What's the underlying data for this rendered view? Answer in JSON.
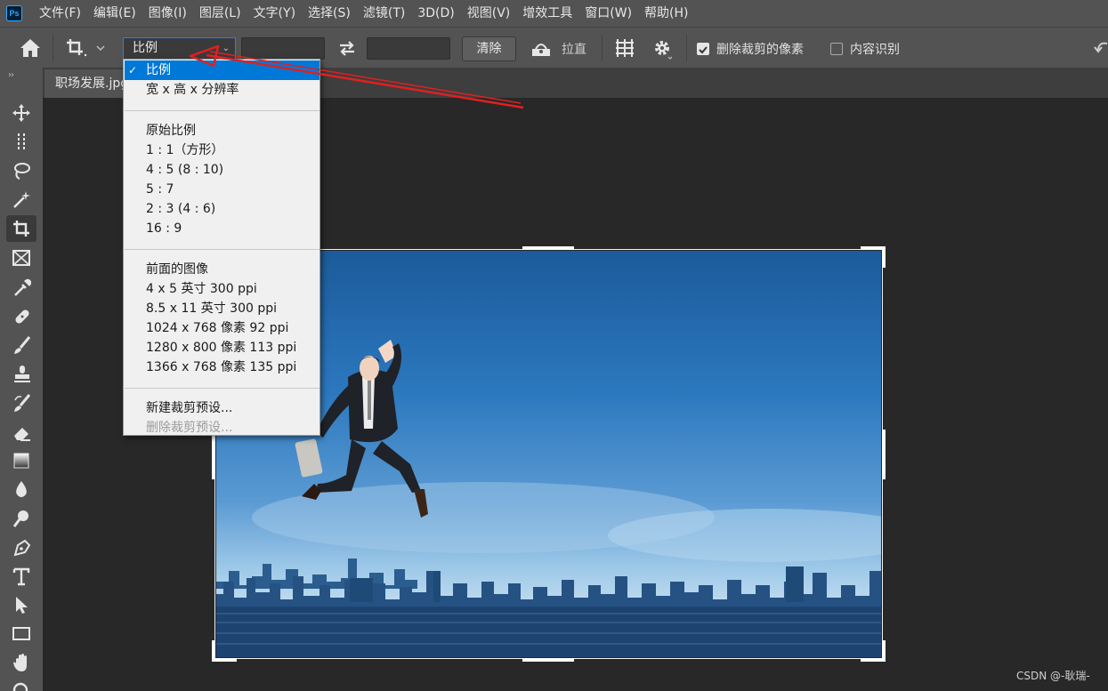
{
  "app": {
    "logo_text": "Ps"
  },
  "menu": [
    "文件(F)",
    "编辑(E)",
    "图像(I)",
    "图层(L)",
    "文字(Y)",
    "选择(S)",
    "滤镜(T)",
    "3D(D)",
    "视图(V)",
    "增效工具",
    "窗口(W)",
    "帮助(H)"
  ],
  "options": {
    "ratio_value": "比例",
    "width_value": "",
    "height_value": "",
    "clear_label": "清除",
    "straighten_label": "拉直",
    "delete_cropped_label": "删除裁剪的像素",
    "delete_cropped_checked": true,
    "content_aware_label": "内容识别",
    "content_aware_checked": false
  },
  "document": {
    "tab_title": "职场发展.jpg"
  },
  "dropdown": {
    "groups": [
      [
        {
          "label": "比例",
          "selected": true
        },
        {
          "label": "宽 x 高 x 分辨率"
        }
      ],
      [
        {
          "label": "原始比例"
        },
        {
          "label": "1 : 1（方形）"
        },
        {
          "label": "4 : 5 (8 : 10)"
        },
        {
          "label": "5 : 7"
        },
        {
          "label": "2 : 3 (4 : 6)"
        },
        {
          "label": "16 : 9"
        }
      ],
      [
        {
          "label": "前面的图像"
        },
        {
          "label": "4 x 5 英寸 300 ppi"
        },
        {
          "label": "8.5 x 11 英寸 300 ppi"
        },
        {
          "label": "1024 x 768 像素 92 ppi"
        },
        {
          "label": "1280 x 800 像素 113 ppi"
        },
        {
          "label": "1366 x 768 像素 135 ppi"
        }
      ],
      [
        {
          "label": "新建裁剪预设..."
        },
        {
          "label": "删除裁剪预设...",
          "disabled": true
        }
      ]
    ]
  },
  "tools": [
    "move-tool-icon",
    "marquee-tool-icon",
    "lasso-tool-icon",
    "magic-wand-tool-icon",
    "crop-tool-icon",
    "frame-tool-icon",
    "eyedropper-tool-icon",
    "healing-brush-tool-icon",
    "brush-tool-icon",
    "stamp-tool-icon",
    "history-brush-tool-icon",
    "eraser-tool-icon",
    "gradient-tool-icon",
    "blur-tool-icon",
    "dodge-tool-icon",
    "pen-tool-icon",
    "type-tool-icon",
    "path-selection-tool-icon",
    "rectangle-tool-icon",
    "hand-tool-icon",
    "zoom-tool-icon"
  ],
  "colors": {
    "accent": "#2680eb",
    "selection": "#0078d7",
    "annotation_arrow": "#e02020"
  },
  "watermark": "CSDN @-耿瑞-"
}
